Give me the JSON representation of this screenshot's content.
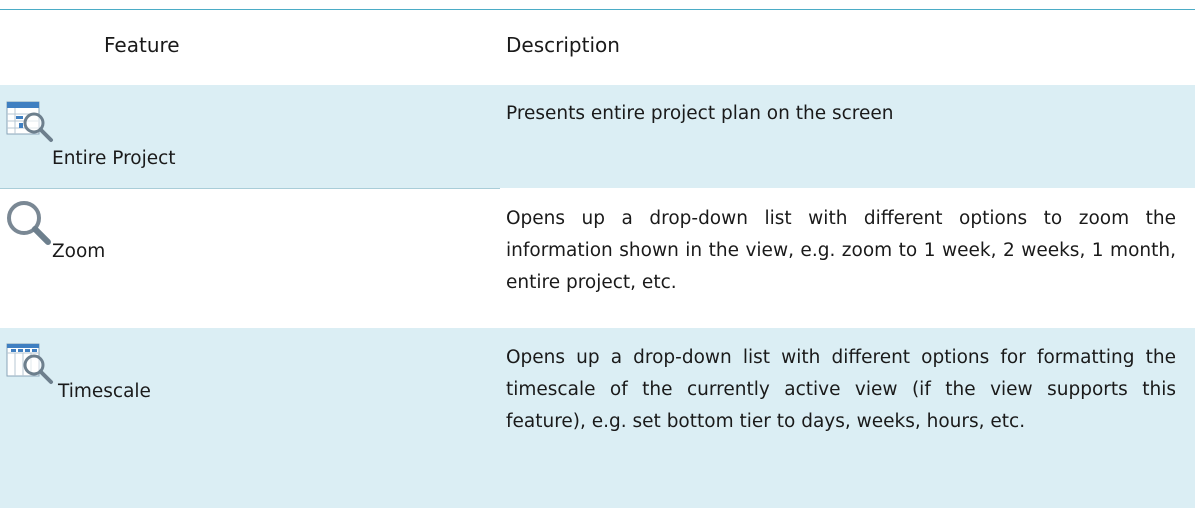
{
  "table": {
    "headers": {
      "feature": "Feature",
      "description": "Description"
    },
    "rows": [
      {
        "icon": "entire-project-icon",
        "feature": "Entire Project",
        "description": "Presents entire project plan on the screen"
      },
      {
        "icon": "zoom-icon",
        "feature": "Zoom",
        "description": "Opens up a drop-down list with different options to zoom the information shown in the view, e.g. zoom to 1 week, 2 weeks, 1 month, entire project, etc."
      },
      {
        "icon": "timescale-icon",
        "feature": "Timescale",
        "description": "Opens up a drop-down list with different options for formatting the timescale of the currently active view (if the view supports this feature), e.g. set bottom tier to days, weeks, hours, etc."
      }
    ]
  },
  "colors": {
    "header_rule": "#4bacc6",
    "row_shade": "#dbeef4",
    "icon_blue": "#3f7fc1"
  }
}
